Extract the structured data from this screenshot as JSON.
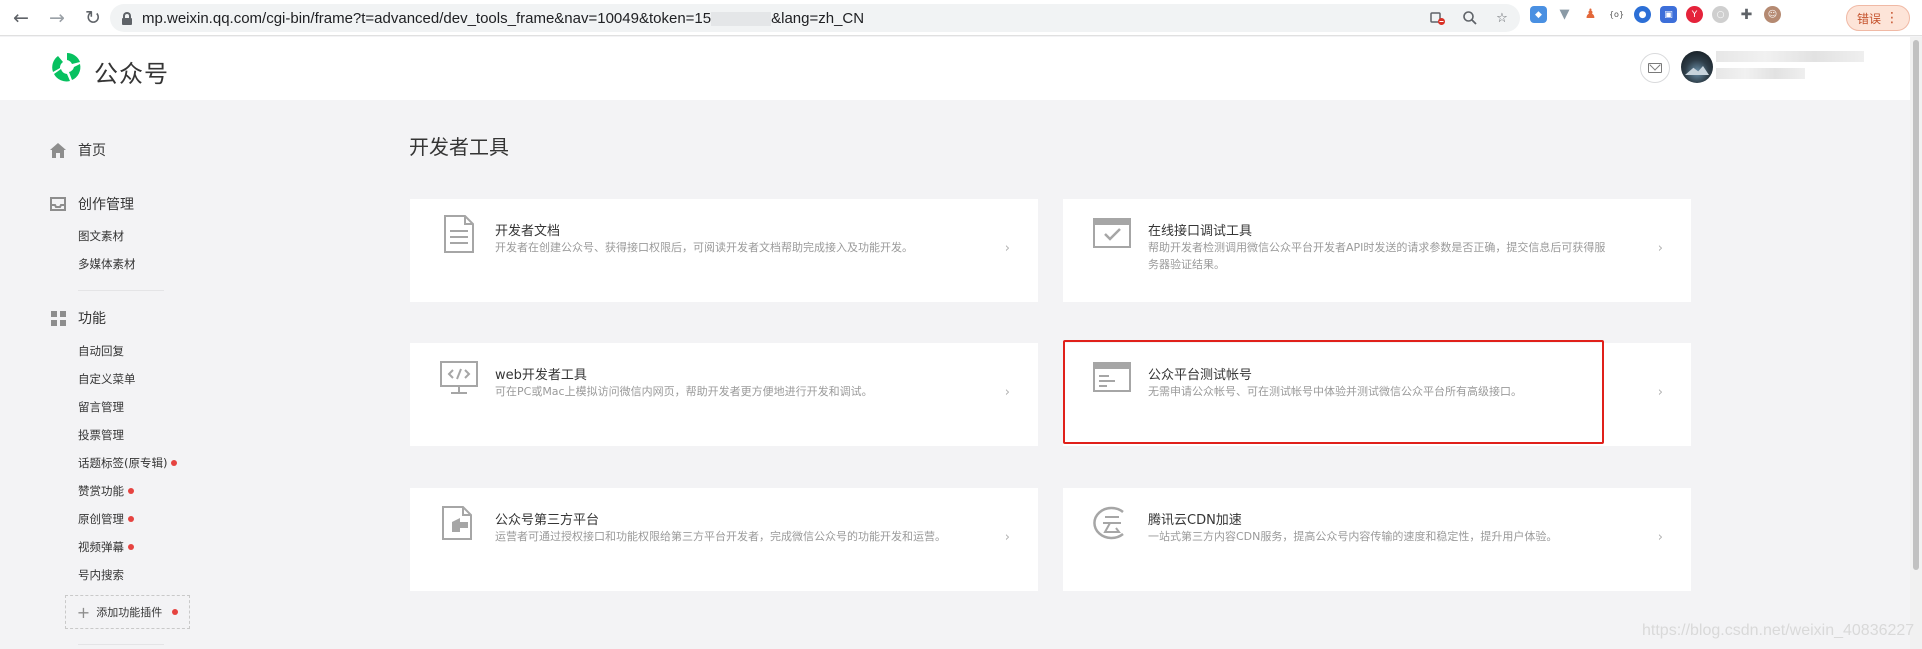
{
  "browser": {
    "url_prefix": "mp.weixin.qq.com/cgi-bin/frame?t=advanced/dev_tools_frame&nav=10049&token=15",
    "url_suffix": "&lang=zh_CN",
    "profile_label": "错误"
  },
  "header": {
    "brand": "公众号"
  },
  "sidebar": {
    "home": "首页",
    "creation": {
      "label": "创作管理",
      "items": [
        "图文素材",
        "多媒体素材"
      ]
    },
    "features": {
      "label": "功能",
      "items": [
        {
          "label": "自动回复",
          "dot": false
        },
        {
          "label": "自定义菜单",
          "dot": false
        },
        {
          "label": "留言管理",
          "dot": false
        },
        {
          "label": "投票管理",
          "dot": false
        },
        {
          "label": "话题标签(原专辑)",
          "dot": true
        },
        {
          "label": "赞赏功能",
          "dot": true
        },
        {
          "label": "原创管理",
          "dot": true
        },
        {
          "label": "视频弹幕",
          "dot": true
        },
        {
          "label": "号内搜索",
          "dot": false
        }
      ]
    },
    "add_plugin": "添加功能插件"
  },
  "main": {
    "title": "开发者工具",
    "cards": [
      {
        "title": "开发者文档",
        "desc": "开发者在创建公众号、获得接口权限后，可阅读开发者文档帮助完成接入及功能开发。",
        "icon": "document-icon"
      },
      {
        "title": "在线接口调试工具",
        "desc": "帮助开发者检测调用微信公众平台开发者API时发送的请求参数是否正确，提交信息后可获得服务器验证结果。",
        "icon": "debug-window-icon"
      },
      {
        "title": "web开发者工具",
        "desc": "可在PC或Mac上模拟访问微信内网页，帮助开发者更方便地进行开发和调试。",
        "icon": "monitor-code-icon"
      },
      {
        "title": "公众平台测试帐号",
        "desc": "无需申请公众帐号、可在测试帐号中体验并测试微信公众平台所有高级接口。",
        "icon": "test-window-icon"
      },
      {
        "title": "公众号第三方平台",
        "desc": "运营者可通过授权接口和功能权限给第三方平台开发者，完成微信公众号的功能开发和运营。",
        "icon": "third-party-icon"
      },
      {
        "title": "腾讯云CDN加速",
        "desc": "一站式第三方内容CDN服务，提高公众号内容传输的速度和稳定性，提升用户体验。",
        "icon": "cloud-icon"
      }
    ],
    "arrow": "›"
  },
  "watermark": "https://blog.csdn.net/weixin_40836227",
  "colors": {
    "highlight": "#e0201a",
    "brand_green": "#07c160",
    "red_dot": "#e64340"
  }
}
